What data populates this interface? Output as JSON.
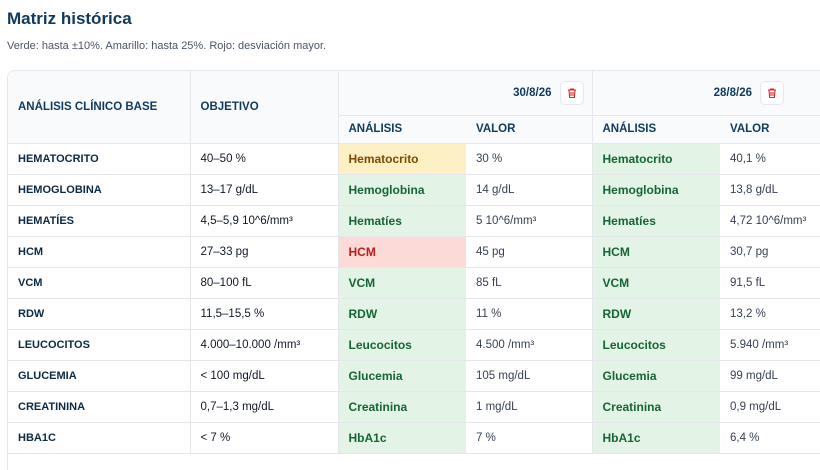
{
  "page": {
    "title": "Matriz histórica",
    "subtitle": "Verde: hasta ±10%. Amarillo: hasta 25%. Rojo: desviación mayor."
  },
  "colors": {
    "green": "#e3f3e6",
    "yellow": "#fdf0c4",
    "red": "#fbdad8",
    "title": "#0f3a5e"
  },
  "table": {
    "headers": {
      "base": "ANÁLISIS CLÍNICO BASE",
      "objective": "OBJETIVO",
      "analysis": "ANÁLISIS",
      "value": "VALOR"
    },
    "dates": [
      {
        "label": "30/8/26",
        "delete_icon": "trash-icon"
      },
      {
        "label": "28/8/26",
        "delete_icon": "trash-icon"
      }
    ],
    "rows": [
      {
        "base": "HEMATOCRITO",
        "objective": "40–50 %",
        "c1": {
          "name": "Hematocrito",
          "value": "30 %",
          "status": "yellow"
        },
        "c2": {
          "name": "Hematocrito",
          "value": "40,1 %",
          "status": "green"
        }
      },
      {
        "base": "HEMOGLOBINA",
        "objective": "13–17 g/dL",
        "c1": {
          "name": "Hemoglobina",
          "value": "14 g/dL",
          "status": "green"
        },
        "c2": {
          "name": "Hemoglobina",
          "value": "13,8 g/dL",
          "status": "green"
        }
      },
      {
        "base": "HEMATÍES",
        "objective": "4,5–5,9 10^6/mm³",
        "c1": {
          "name": "Hematíes",
          "value": "5 10^6/mm³",
          "status": "green"
        },
        "c2": {
          "name": "Hematíes",
          "value": "4,72 10^6/mm³",
          "status": "green"
        }
      },
      {
        "base": "HCM",
        "objective": "27–33 pg",
        "c1": {
          "name": "HCM",
          "value": "45 pg",
          "status": "red"
        },
        "c2": {
          "name": "HCM",
          "value": "30,7 pg",
          "status": "green"
        }
      },
      {
        "base": "VCM",
        "objective": "80–100 fL",
        "c1": {
          "name": "VCM",
          "value": "85 fL",
          "status": "green"
        },
        "c2": {
          "name": "VCM",
          "value": "91,5 fL",
          "status": "green"
        }
      },
      {
        "base": "RDW",
        "objective": "11,5–15,5 %",
        "c1": {
          "name": "RDW",
          "value": "11 %",
          "status": "green"
        },
        "c2": {
          "name": "RDW",
          "value": "13,2 %",
          "status": "green"
        }
      },
      {
        "base": "LEUCOCITOS",
        "objective": "4.000–10.000 /mm³",
        "c1": {
          "name": "Leucocitos",
          "value": "4.500 /mm³",
          "status": "green"
        },
        "c2": {
          "name": "Leucocitos",
          "value": "5.940 /mm³",
          "status": "green"
        }
      },
      {
        "base": "GLUCEMIA",
        "objective": "< 100 mg/dL",
        "c1": {
          "name": "Glucemia",
          "value": "105 mg/dL",
          "status": "green"
        },
        "c2": {
          "name": "Glucemia",
          "value": "99 mg/dL",
          "status": "green"
        }
      },
      {
        "base": "CREATININA",
        "objective": "0,7–1,3 mg/dL",
        "c1": {
          "name": "Creatinina",
          "value": "1 mg/dL",
          "status": "green"
        },
        "c2": {
          "name": "Creatinina",
          "value": "0,9 mg/dL",
          "status": "green"
        }
      },
      {
        "base": "HBA1C",
        "objective": "< 7 %",
        "c1": {
          "name": "HbA1c",
          "value": "7 %",
          "status": "green"
        },
        "c2": {
          "name": "HbA1c",
          "value": "6,4 %",
          "status": "green"
        }
      }
    ]
  }
}
